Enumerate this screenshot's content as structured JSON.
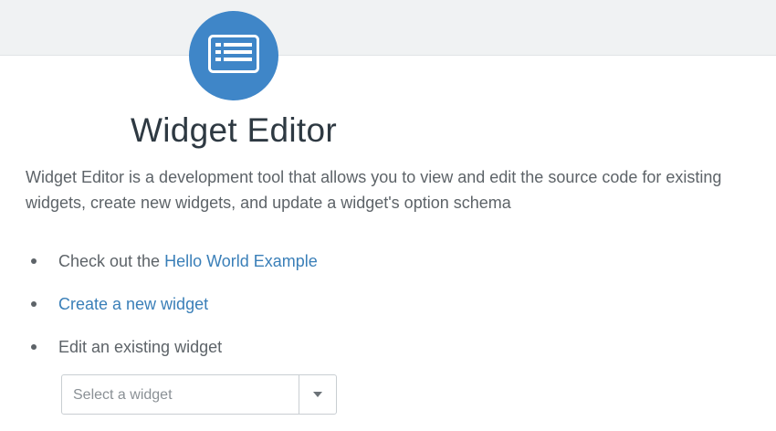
{
  "header": {
    "icon": "list-window-icon",
    "title": "Widget Editor"
  },
  "description": "Widget Editor is a development tool that allows you to view and edit the source code for existing widgets, create new widgets, and update a widget's option schema",
  "actions": {
    "item1_prefix": "Check out the ",
    "item1_link": "Hello World Example",
    "item2_link": "Create a new widget",
    "item3_text": "Edit an existing widget"
  },
  "widget_select": {
    "placeholder": "Select a widget",
    "arrow_icon": "caret-down-icon"
  },
  "colors": {
    "accent": "#3f86c8",
    "link": "#3a7fb8",
    "title": "#2e3942",
    "text": "#5d6368"
  }
}
